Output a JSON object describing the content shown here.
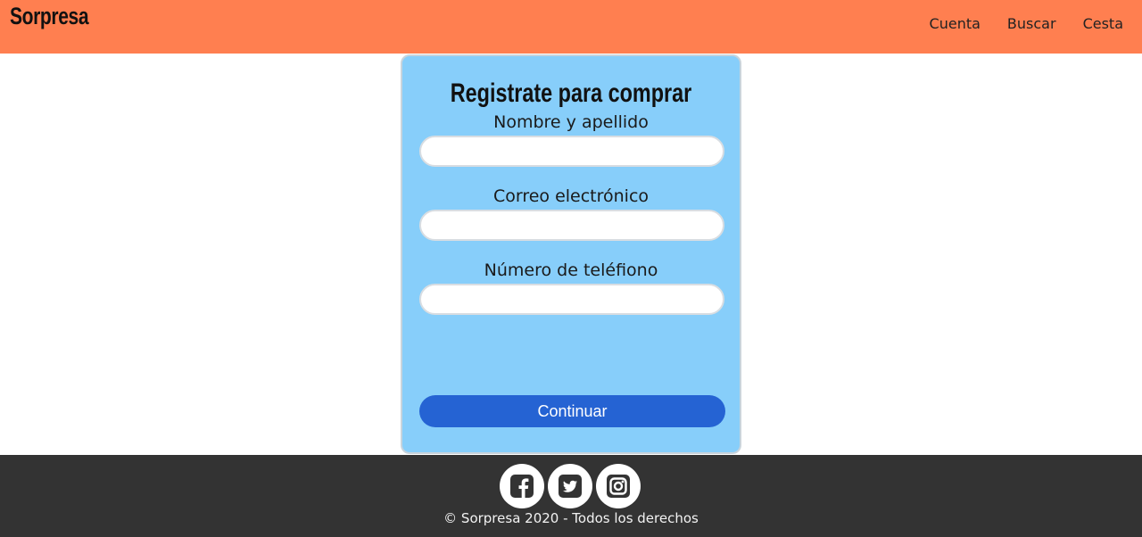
{
  "header": {
    "logo": "Sorpresa",
    "nav": [
      {
        "label": "Cuenta"
      },
      {
        "label": "Buscar"
      },
      {
        "label": "Cesta"
      }
    ],
    "background_color": "#ff7f50"
  },
  "form": {
    "title": "Registrate para comprar",
    "fields": [
      {
        "label": "Nombre y apellido",
        "value": "",
        "placeholder": ""
      },
      {
        "label": "Correo electrónico",
        "value": "",
        "placeholder": ""
      },
      {
        "label": "Número de teléfiono",
        "value": "",
        "placeholder": ""
      }
    ],
    "submit_label": "Continuar",
    "background_color": "#87cefa",
    "button_color": "#2563d3"
  },
  "footer": {
    "social": [
      {
        "icon": "facebook-icon"
      },
      {
        "icon": "twitter-icon"
      },
      {
        "icon": "instagram-icon"
      }
    ],
    "copyright": "© Sorpresa 2020 - Todos los derechos",
    "background_color": "#333333"
  }
}
